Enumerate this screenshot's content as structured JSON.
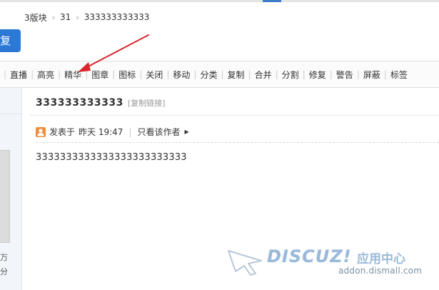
{
  "breadcrumb": {
    "items": [
      "3版块",
      "31",
      "333333333333"
    ],
    "separator": "›"
  },
  "reply_button": {
    "label": "复"
  },
  "mod_bar": {
    "items": [
      "直播",
      "高亮",
      "精华",
      "图章",
      "图标",
      "关闭",
      "移动",
      "分类",
      "复制",
      "合并",
      "分割",
      "修复",
      "警告",
      "屏蔽",
      "标签"
    ]
  },
  "thread": {
    "title": "333333333333",
    "copy_link": "[复制链接]"
  },
  "post": {
    "posted_prefix": "发表于",
    "posted_time": "昨天 19:47",
    "only_author": "只看该作者",
    "content": "3333333333333333333333333"
  },
  "left_panel": {
    "text_1": "万",
    "text_2": "分"
  },
  "watermark": {
    "logo": "DISCUZ!",
    "subtitle": "应用中心",
    "url": "addon.dismall.com"
  },
  "colors": {
    "reply_button": "#2b79d4",
    "user_icon": "#f08c3c",
    "annotation_arrow": "#d9262b",
    "watermark": "#9ab9d9"
  }
}
